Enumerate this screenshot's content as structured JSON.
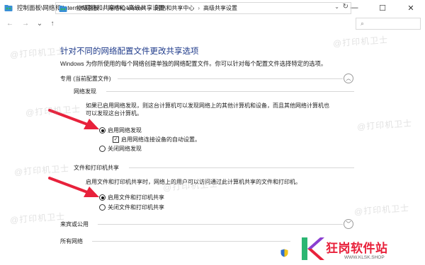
{
  "window": {
    "title": "控制面板\\网络和 Internet\\网络和共享中心\\高级共享设置",
    "minimize_glyph": "—",
    "maximize_glyph": "☐",
    "close_glyph": "✕"
  },
  "nav": {
    "back_glyph": "←",
    "forward_glyph": "→",
    "recent_glyph": "⌄",
    "up_glyph": "↑"
  },
  "address": {
    "crumbs": [
      "控制面板",
      "网络和 Internet",
      "网络和共享中心",
      "高级共享设置"
    ],
    "separator": "›",
    "dropdown_glyph": "⌄",
    "refresh_glyph": "↻"
  },
  "search": {
    "glyph": "⌕"
  },
  "page": {
    "heading": "针对不同的网络配置文件更改共享选项",
    "description": "Windows 为你所使用的每个网络创建单独的网络配置文件。你可以针对每个配置文件选择特定的选项。"
  },
  "profile_private": {
    "title": "专用 (当前配置文件)",
    "collapse_glyph": "︿",
    "network_discovery": {
      "title": "网络发现",
      "paragraph_line1": "如果已启用网络发现，则这台计算机可以发现网络上的其他计算机和设备，而且其他网络计算机也",
      "paragraph_line2": "可以发现这台计算机。",
      "options": {
        "enable": "启用网络发现",
        "auto_setup": "启用网络连接设备的自动设置。",
        "disable": "关闭网络发现"
      },
      "checkbox_glyph": "✓"
    },
    "file_printer_sharing": {
      "title": "文件和打印机共享",
      "paragraph": "启用文件和打印机共享时，网络上的用户可以访问通过此计算机共享的文件和打印机。",
      "options": {
        "enable": "启用文件和打印机共享",
        "disable": "关闭文件和打印机共享"
      }
    }
  },
  "profile_guest": {
    "title": "来宾或公用",
    "collapse_glyph": "﹀"
  },
  "profile_all": {
    "title": "所有网络"
  },
  "watermark": {
    "text": "@打印机卫士"
  },
  "logo": {
    "mark": "K",
    "name": "狂岗软件站",
    "url": "WWW.KLSK.SHOP"
  },
  "colors": {
    "heading": "#1e3a8a",
    "arrow": "#e8213b",
    "logo_red": "#e8213b",
    "logo_green": "#2bb673",
    "logo_purple": "#8b3fd1"
  },
  "icons": {
    "titlebar": "network-folder-icon",
    "address": "network-folder-icon",
    "shield": "uac-shield-icon"
  }
}
